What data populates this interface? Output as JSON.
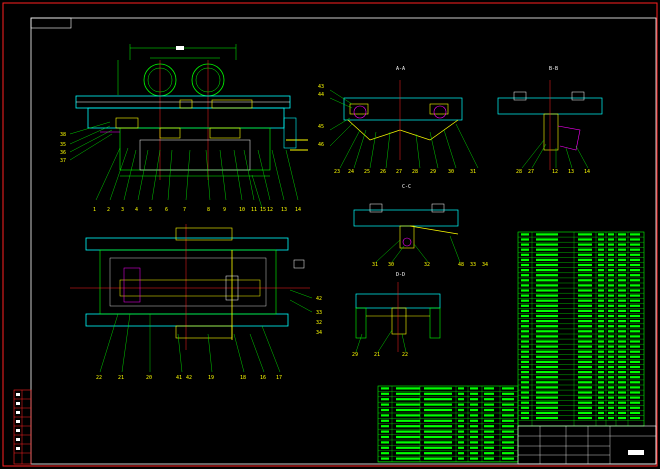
{
  "views": {
    "section_a": "A-A",
    "section_b": "B-B",
    "section_c": "C-C",
    "section_d": "D-D"
  },
  "front_view_labels": [
    "1",
    "2",
    "3",
    "4",
    "5",
    "6",
    "7",
    "8",
    "9",
    "10",
    "11",
    "12",
    "13",
    "14",
    "15"
  ],
  "front_left_labels": [
    "38",
    "35",
    "36",
    "37"
  ],
  "top_view_bottom_labels": [
    "22",
    "21",
    "20",
    "41",
    "42",
    "19",
    "18",
    "16",
    "17"
  ],
  "top_view_right_labels": [
    "42",
    "33",
    "32",
    "34"
  ],
  "section_a_labels": [
    "23",
    "24",
    "25",
    "26",
    "27",
    "28",
    "29",
    "30",
    "31",
    "43",
    "44",
    "45",
    "46"
  ],
  "section_b_labels": [
    "28",
    "27",
    "12",
    "13",
    "14"
  ],
  "section_c_labels": [
    "31",
    "30",
    "32",
    "48",
    "33",
    "34"
  ],
  "section_d_labels": [
    "29",
    "21",
    "22"
  ],
  "title_block": {
    "label": ""
  },
  "colors": {
    "border": "#ff2020",
    "frame": "#ffffff",
    "green": "#00ff00",
    "cyan": "#00ffff",
    "yellow": "#ffff00",
    "magenta": "#ff00ff"
  }
}
